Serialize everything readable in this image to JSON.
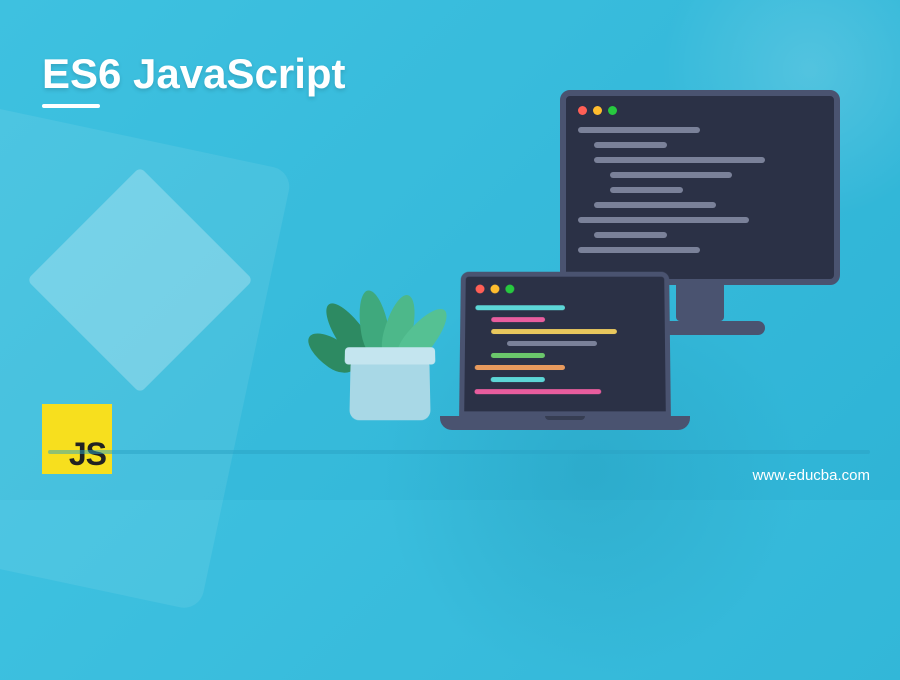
{
  "page": {
    "title": "ES6 JavaScript",
    "website_url": "www.educba.com"
  },
  "js_logo": {
    "text": "JS",
    "bg_color": "#f7df1e"
  },
  "illustration": {
    "monitor": {
      "dots": [
        "red",
        "yellow",
        "green"
      ]
    },
    "laptop": {
      "dots": [
        "red",
        "yellow",
        "green"
      ]
    },
    "plant": {
      "pot_color": "#a8d8e6"
    }
  }
}
